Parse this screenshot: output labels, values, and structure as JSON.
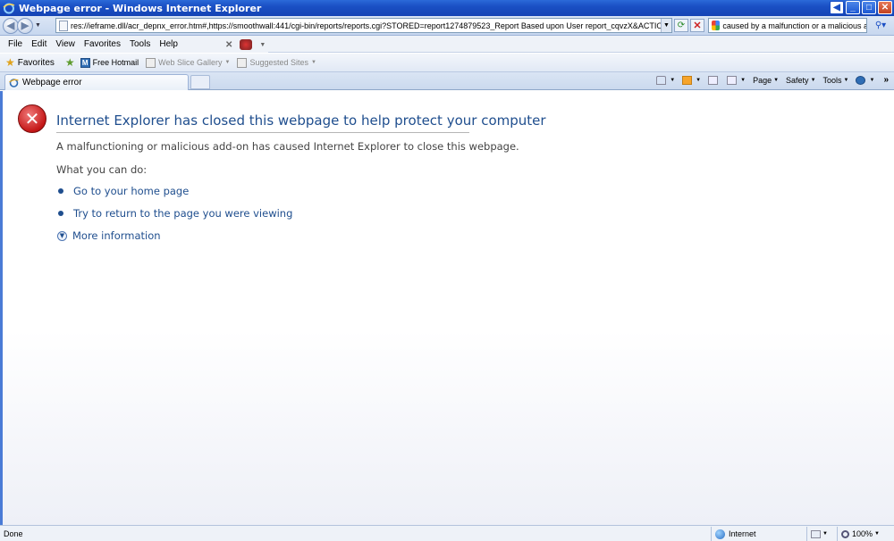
{
  "window": {
    "title": "Webpage error - Windows Internet Explorer",
    "controls": {
      "minimize": "_",
      "maximize": "□",
      "close": "✕",
      "back": "◀"
    }
  },
  "address": {
    "url": "res://ieframe.dll/acr_depnx_error.htm#,https://smoothwall:441/cgi-bin/reports/reports.cgi?STORED=report1274879523_Report Based upon User report_cqvzX&ACTION=Preview",
    "search_query": "caused by a malfunction or a malicious add-on."
  },
  "menu": {
    "items": [
      "File",
      "Edit",
      "View",
      "Favorites",
      "Tools",
      "Help"
    ]
  },
  "favorites_bar": {
    "favorites_label": "Favorites",
    "items": [
      {
        "label": "Free Hotmail",
        "icon": "hotmail-icon"
      },
      {
        "label": "Web Slice Gallery",
        "icon": "ie-page-icon"
      },
      {
        "label": "Suggested Sites",
        "icon": "ie-page-icon"
      }
    ]
  },
  "tabs": [
    {
      "title": "Webpage error"
    }
  ],
  "command_bar": {
    "page": "Page",
    "safety": "Safety",
    "tools": "Tools"
  },
  "error_page": {
    "title": "Internet Explorer has closed this webpage to help protect your computer",
    "description": "A malfunctioning or malicious add-on has caused Internet Explorer to close this webpage.",
    "what_you_can_do": "What you can do:",
    "options": [
      "Go to your home page",
      "Try to return to the page you were viewing",
      "More information"
    ]
  },
  "status": {
    "text": "Done",
    "zone": "Internet",
    "zoom": "100%"
  },
  "colors": {
    "title_bar": "#1a4fc4",
    "error_title": "#1f4e8e",
    "error_icon": "#c41717"
  }
}
